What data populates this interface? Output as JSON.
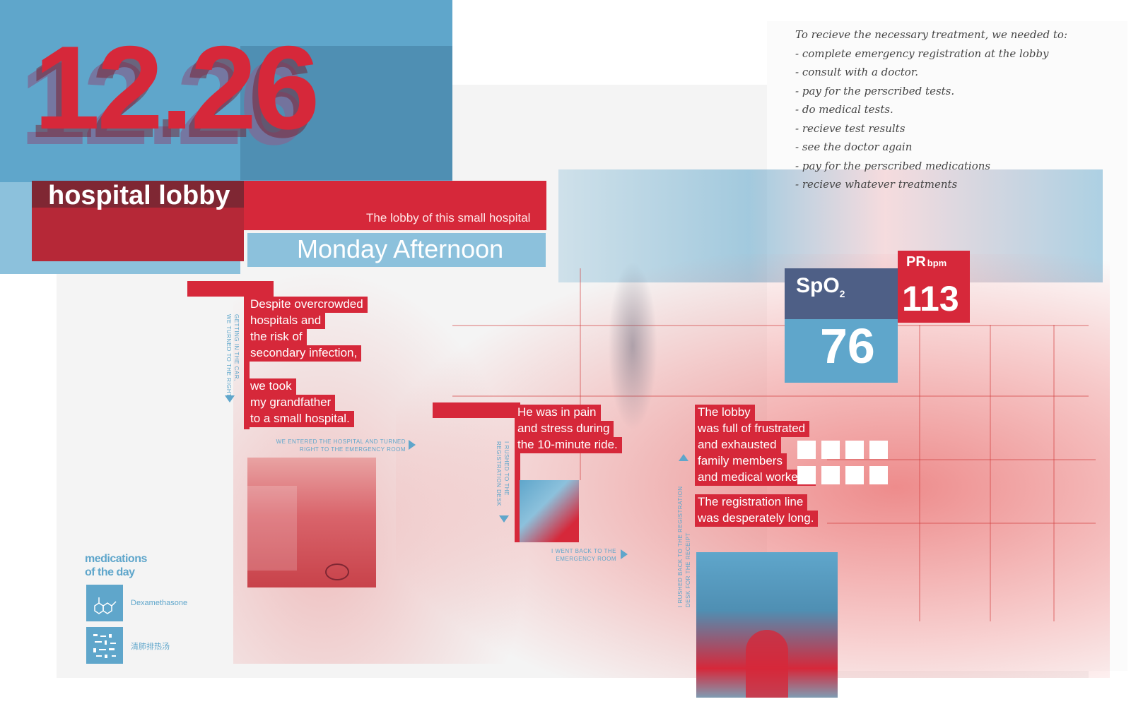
{
  "header": {
    "date": "12.26",
    "place": "hospital lobby",
    "lobby_desc": "The lobby of this small hospital",
    "time": "Monday Afternoon"
  },
  "story": {
    "block1": [
      "Despite overcrowded",
      "hospitals and",
      "the risk of",
      "secondary infection,",
      "we took",
      "my grandfather",
      "to a small hospital."
    ],
    "block2": [
      "He was in pain",
      "and stress during",
      "the 10-minute ride."
    ],
    "block3": [
      "The lobby",
      "was full of frustrated",
      "and exhausted",
      "family members",
      "and medical workers.",
      "The registration line",
      "was desperately long."
    ]
  },
  "captions": {
    "car": [
      "GETTING IN THE CAR,",
      "WE TURNED TO THE RIGHT"
    ],
    "entered": [
      "WE ENTERED THE HOSPITAL AND TURNED",
      "RIGHT TO THE EMERGENCY ROOM"
    ],
    "rushed": [
      "I RUSHED TO THE",
      "REGISTRATION DESK"
    ],
    "went_back": [
      "I WENT BACK TO THE",
      "EMERGENCY ROOM"
    ],
    "receipt": [
      "I RUSHED BACK TO THE REGISTRATION",
      "DESK FOR THE RECEIPT"
    ]
  },
  "vitals": {
    "spo2_label": "SpO",
    "spo2_sub": "2",
    "spo2_value": "76",
    "pr_label": "PR",
    "pr_unit": "bpm",
    "pr_value": "113"
  },
  "note": {
    "lines": [
      "To recieve the necessary treatment, we needed to:",
      "- complete emergency registration at the lobby",
      "- consult with a doctor.",
      "- pay for the perscribed tests.",
      "- do medical tests.",
      "- recieve test results",
      "- see the doctor again",
      "- pay for the perscribed medications",
      "- recieve whatever treatments"
    ]
  },
  "medications": {
    "title_line1": "medications",
    "title_line2": "of the day",
    "items": [
      "Dexamethasone",
      "清肺排热汤"
    ]
  },
  "colors": {
    "red": "#d6283a",
    "blue": "#5fa6cb",
    "dark": "#7f2733"
  }
}
